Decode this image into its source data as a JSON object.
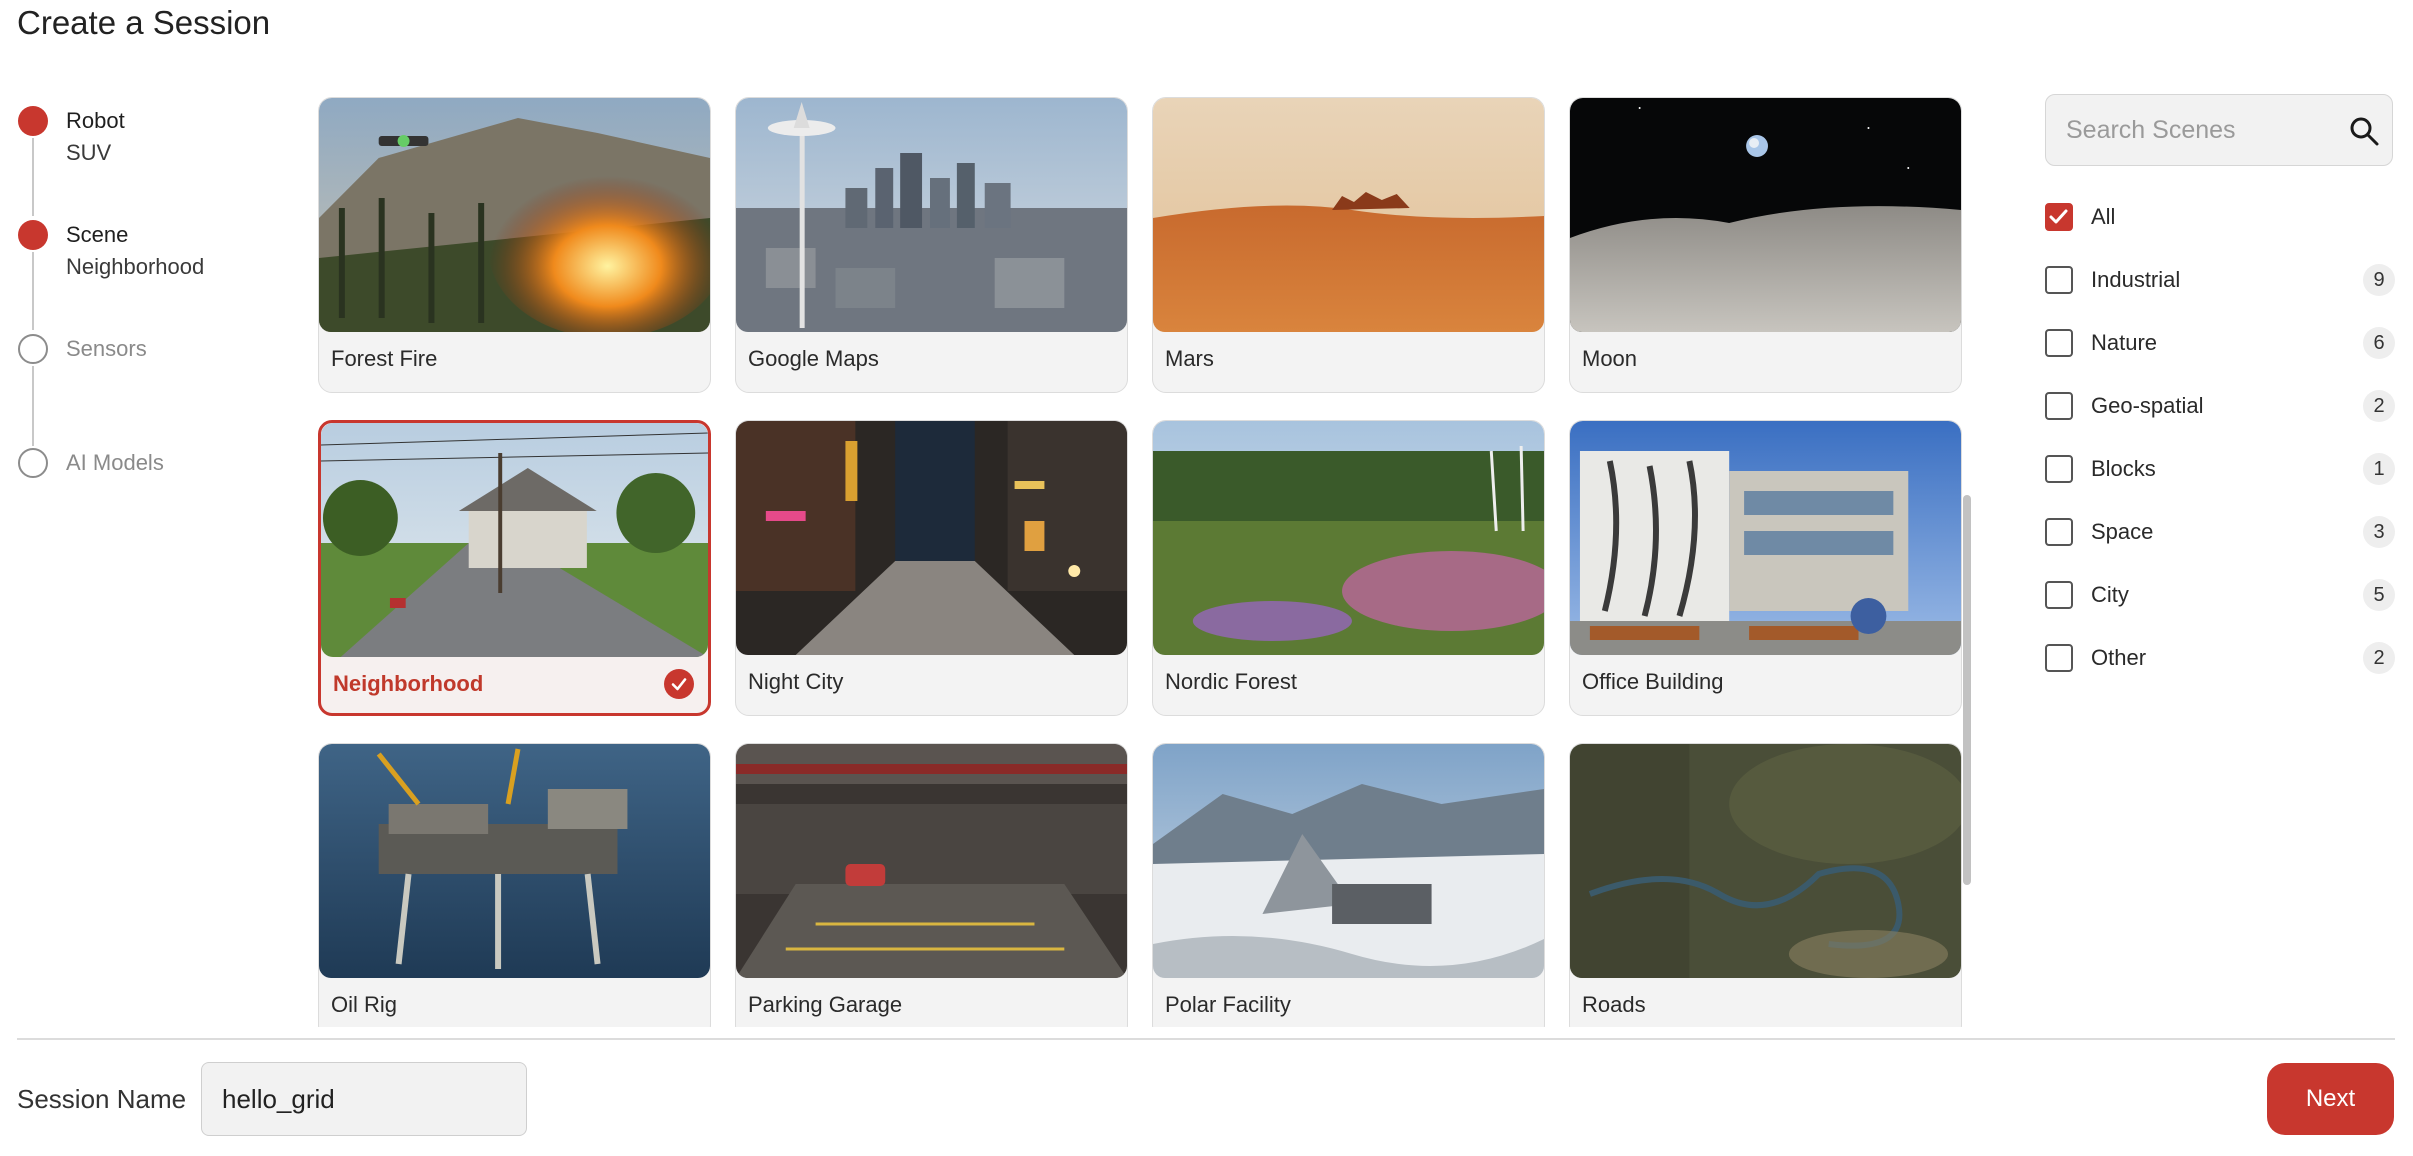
{
  "page": {
    "title": "Create a Session"
  },
  "stepper": {
    "steps": [
      {
        "label": "Robot",
        "value": "SUV",
        "state": "complete"
      },
      {
        "label": "Scene",
        "value": "Neighborhood",
        "state": "complete"
      },
      {
        "label": "Sensors",
        "value": "",
        "state": "pending"
      },
      {
        "label": "AI Models",
        "value": "",
        "state": "pending"
      }
    ]
  },
  "scenes": [
    {
      "name": "Forest Fire",
      "selected": false
    },
    {
      "name": "Google Maps",
      "selected": false
    },
    {
      "name": "Mars",
      "selected": false
    },
    {
      "name": "Moon",
      "selected": false
    },
    {
      "name": "Neighborhood",
      "selected": true
    },
    {
      "name": "Night City",
      "selected": false
    },
    {
      "name": "Nordic Forest",
      "selected": false
    },
    {
      "name": "Office Building",
      "selected": false
    },
    {
      "name": "Oil Rig",
      "selected": false
    },
    {
      "name": "Parking Garage",
      "selected": false
    },
    {
      "name": "Polar Facility",
      "selected": false
    },
    {
      "name": "Roads",
      "selected": false
    }
  ],
  "search": {
    "placeholder": "Search Scenes",
    "value": "",
    "icon": "search-icon"
  },
  "filters": [
    {
      "label": "All",
      "checked": true,
      "count": ""
    },
    {
      "label": "Industrial",
      "checked": false,
      "count": "9"
    },
    {
      "label": "Nature",
      "checked": false,
      "count": "6"
    },
    {
      "label": "Geo-spatial",
      "checked": false,
      "count": "2"
    },
    {
      "label": "Blocks",
      "checked": false,
      "count": "1"
    },
    {
      "label": "Space",
      "checked": false,
      "count": "3"
    },
    {
      "label": "City",
      "checked": false,
      "count": "5"
    },
    {
      "label": "Other",
      "checked": false,
      "count": "2"
    }
  ],
  "footer": {
    "session_name_label": "Session Name",
    "session_name_value": "hello_grid",
    "next_label": "Next"
  },
  "colors": {
    "accent": "#c8372e",
    "selected_text": "#c0392b",
    "card_bg": "#f3f3f3"
  }
}
